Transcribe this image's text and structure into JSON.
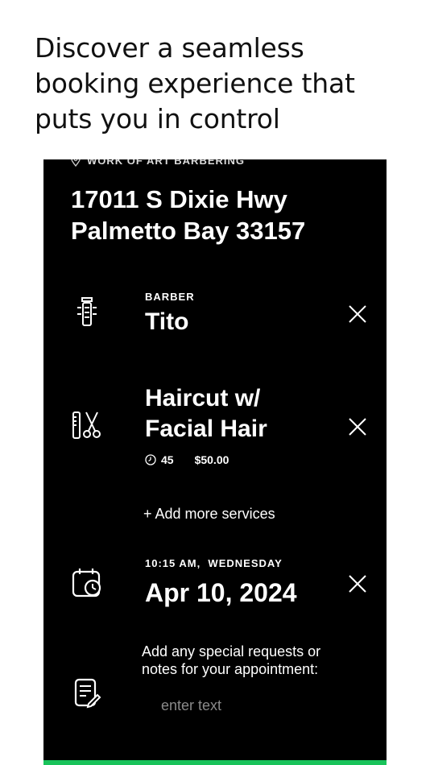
{
  "headline": "Discover a seamless booking experience that puts you in control",
  "shop": {
    "name": "WORK OF ART BARBERING",
    "address": "17011 S Dixie Hwy\nPalmetto Bay 33157"
  },
  "barber": {
    "label": "BARBER",
    "name": "Tito"
  },
  "service": {
    "name": "Haircut w/ Facial Hair",
    "duration": "45",
    "price": "$50.00"
  },
  "add_more_label": "+ Add more services",
  "appointment": {
    "time_day": "10:15 AM,  WEDNESDAY",
    "date": "Apr 10, 2024"
  },
  "notes": {
    "label": "Add any special requests or notes for your appointment:",
    "placeholder": "enter text"
  },
  "colors": {
    "background": "#000000",
    "accent": "#19c35a"
  },
  "icons": [
    "location-pin-icon",
    "clipper-icon",
    "comb-scissors-icon",
    "calendar-clock-icon",
    "notes-icon",
    "close-icon",
    "clock-icon"
  ]
}
